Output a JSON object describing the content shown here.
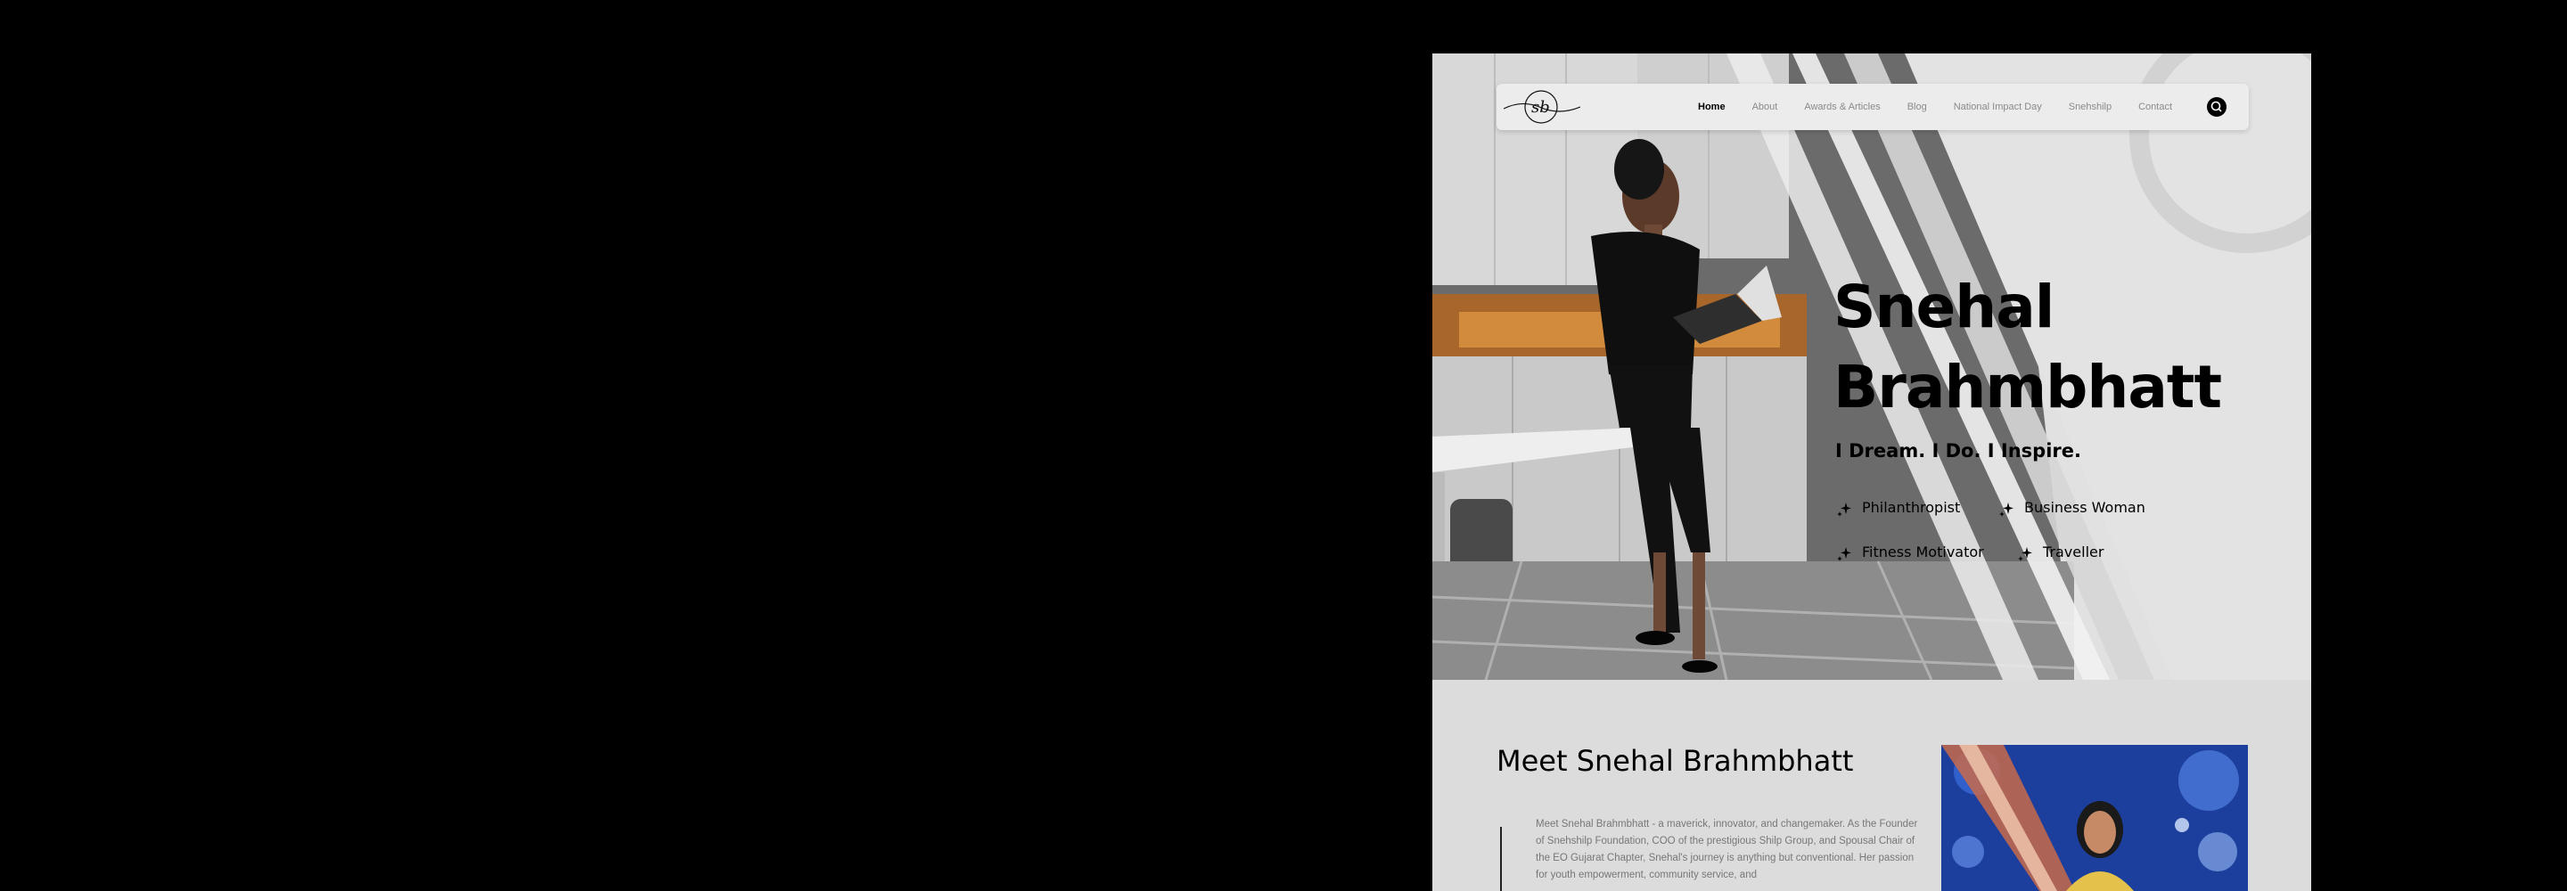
{
  "nav": {
    "logo_text": "sb",
    "links": [
      "Home",
      "About",
      "Awards & Articles",
      "Blog",
      "National Impact Day",
      "Snehshilp",
      "Contact"
    ],
    "search_icon": "search-icon"
  },
  "hero": {
    "name_line1": "Snehal",
    "name_line2": "Brahmbhatt",
    "tagline": "I Dream. I Do. I Inspire.",
    "roles": [
      "Philanthropist",
      "Business Woman",
      "Fitness Motivator",
      "Traveller"
    ],
    "role_icon": "sparkle-icon"
  },
  "meet": {
    "title": "Meet Snehal Brahmbhatt",
    "paragraph": "Meet Snehal Brahmbhatt - a maverick, innovator, and changemaker. As the Founder of Snehshilp Foundation, COO of the prestigious Shilp Group, and Spousal Chair of the EO Gujarat Chapter, Snehal's journey is anything but conventional. Her passion for youth empowerment, community service, and"
  },
  "colors": {
    "accent": "#000000",
    "page_bg": "#000000",
    "hero_bg": "#e1e1e1",
    "section_bg": "#dcdcdc"
  }
}
